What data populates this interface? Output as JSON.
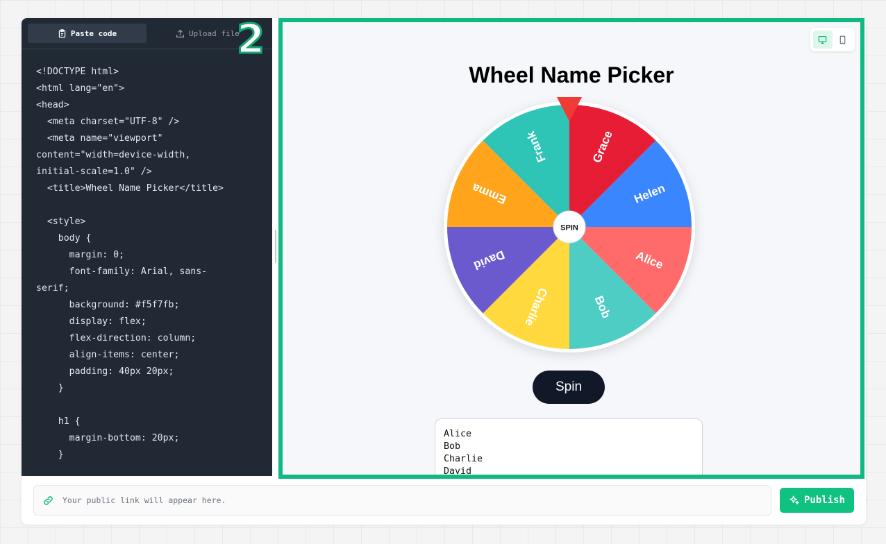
{
  "editor": {
    "tabs": {
      "paste": "Paste code",
      "upload": "Upload file"
    },
    "code_lines": [
      "<!DOCTYPE html>",
      "<html lang=\"en\">",
      "<head>",
      "  <meta charset=\"UTF-8\" />",
      "  <meta name=\"viewport\"",
      "content=\"width=device-width,",
      "initial-scale=1.0\" />",
      "  <title>Wheel Name Picker</title>",
      "",
      "  <style>",
      "    body {",
      "      margin: 0;",
      "      font-family: Arial, sans-",
      "serif;",
      "      background: #f5f7fb;",
      "      display: flex;",
      "      flex-direction: column;",
      "      align-items: center;",
      "      padding: 40px 20px;",
      "    }",
      "",
      "    h1 {",
      "      margin-bottom: 20px;",
      "    }"
    ]
  },
  "step_badge": "2",
  "preview": {
    "device_toggle": {
      "desktop_icon": "monitor-icon",
      "mobile_icon": "smartphone-icon",
      "active": "desktop"
    },
    "title": "Wheel Name Picker",
    "wheel": {
      "center_label": "SPIN",
      "pointer_color": "#ef3b36",
      "segments": [
        {
          "name": "Alice",
          "color": "#ff6b6b"
        },
        {
          "name": "Bob",
          "color": "#4ecdc4"
        },
        {
          "name": "Charlie",
          "color": "#ffd93d"
        },
        {
          "name": "David",
          "color": "#6a5acd"
        },
        {
          "name": "Emma",
          "color": "#ffa41b"
        },
        {
          "name": "Frank",
          "color": "#2ec4b6"
        },
        {
          "name": "Grace",
          "color": "#e71d36"
        },
        {
          "name": "Helen",
          "color": "#3a86ff"
        }
      ]
    },
    "spin_button": "Spin",
    "names_text": "Alice\nBob\nCharlie\nDavid\nEmma\nFrank\nGrace\nHelen"
  },
  "footer": {
    "link_placeholder": "Your public link will appear here.",
    "publish_label": "Publish",
    "accent": "#10c27f"
  }
}
